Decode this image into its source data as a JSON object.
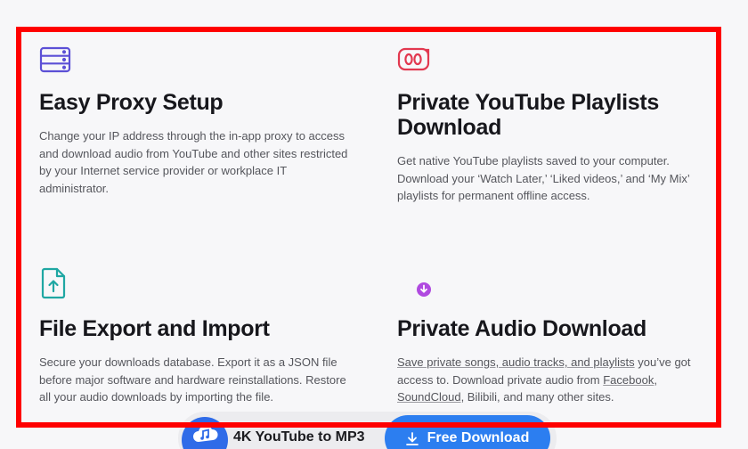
{
  "features": [
    {
      "icon": "server-stack-icon",
      "title": "Easy Proxy Setup",
      "description": "Change your IP address through the in-app proxy to access and download audio from YouTube and other sites restricted by your Internet service provider or workplace IT administrator."
    },
    {
      "icon": "private-playlist-icon",
      "title": "Private YouTube Playlists Download",
      "description": "Get native YouTube playlists saved to your computer. Download your ‘Watch Later,’ ‘Liked videos,’ and ‘My Mix’ playlists for permanent offline access."
    },
    {
      "icon": "file-upload-icon",
      "title": "File Export and Import",
      "description": "Secure your downloads database. Export it as a JSON file before major software and hardware reinstallations. Restore all your audio downloads by importing the file."
    },
    {
      "icon": "audio-download-icon",
      "title": "Private Audio Download",
      "description_link": "Save private songs, audio tracks, and playlists",
      "description_mid": " you’ve got access to. Download private audio from ",
      "link_facebook": "Facebook",
      "sep": ", ",
      "link_soundcloud": "SoundCloud",
      "description_end": ", Bilibili, and many other sites."
    }
  ],
  "bottom_bar": {
    "app_name": "4K YouTube to MP3",
    "download_label": "Free Download"
  },
  "colors": {
    "accent_blue": "#2c7ef0",
    "highlight": "#ff0000",
    "proxy_icon": "#5b4fd6",
    "playlist_icon": "#e2384f",
    "file_icon": "#1fa7a3"
  }
}
